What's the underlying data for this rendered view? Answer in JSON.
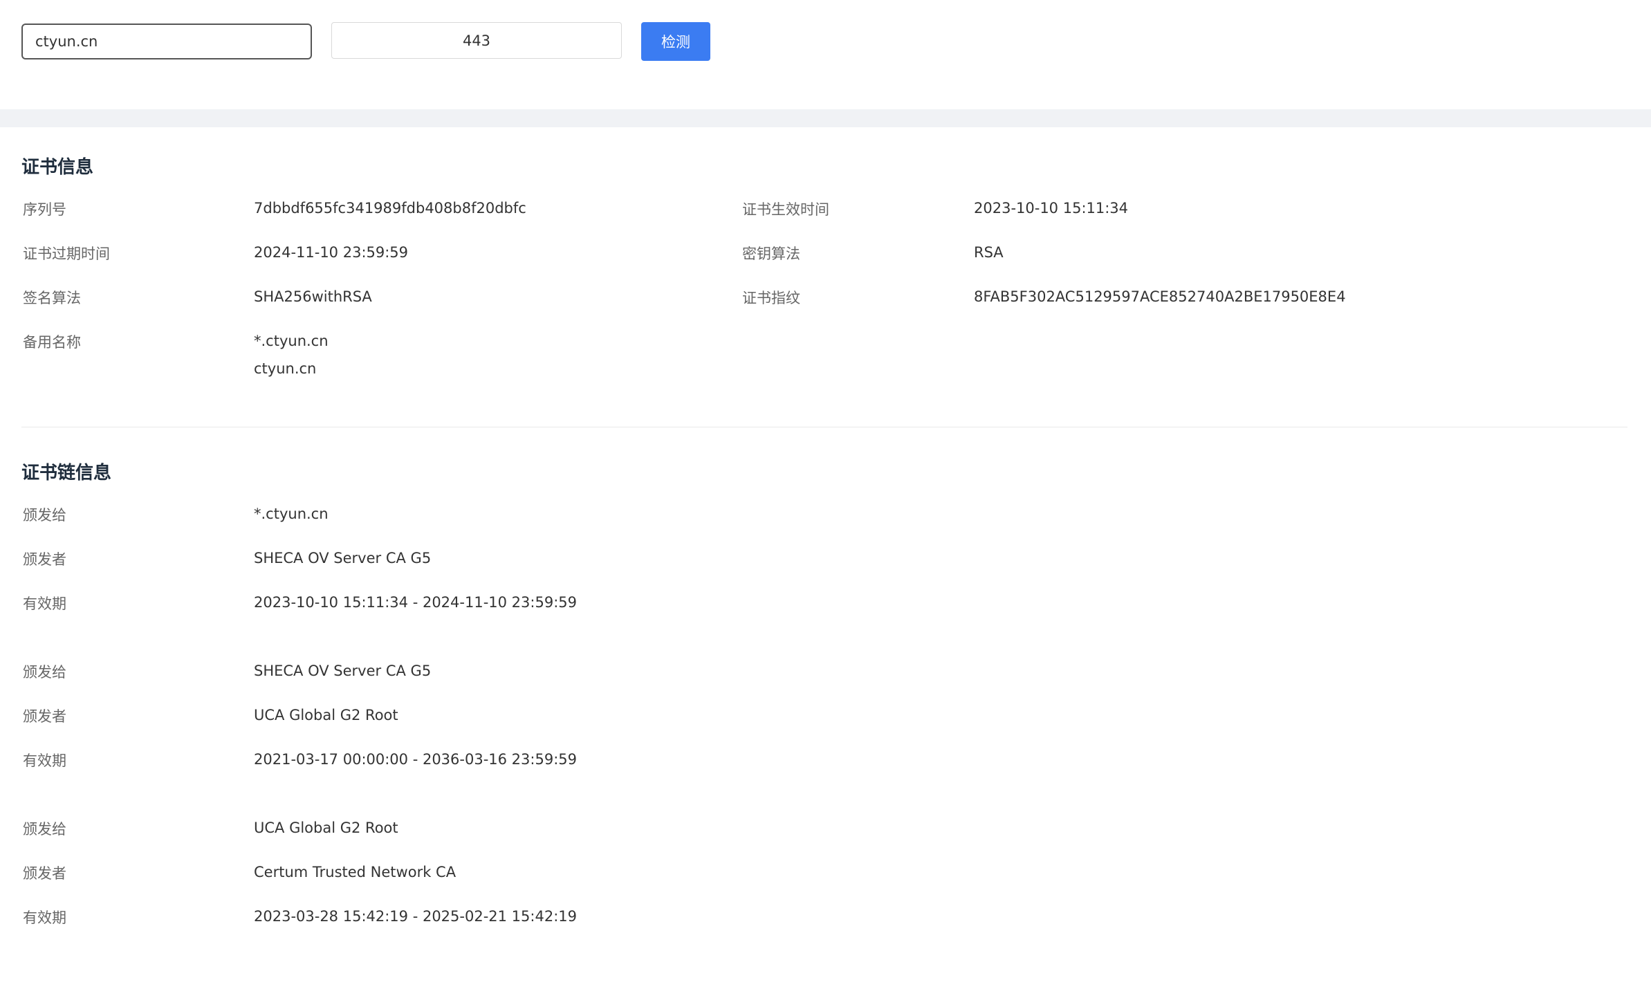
{
  "search": {
    "domain_value": "ctyun.cn",
    "port_value": "443",
    "check_label": "检测"
  },
  "cert_info": {
    "title": "证书信息",
    "serial_label": "序列号",
    "serial_value": "7dbbdf655fc341989fdb408b8f20dbfc",
    "valid_from_label": "证书生效时间",
    "valid_from_value": "2023-10-10 15:11:34",
    "expire_label": "证书过期时间",
    "expire_value": "2024-11-10 23:59:59",
    "key_algo_label": "密钥算法",
    "key_algo_value": "RSA",
    "sig_algo_label": "签名算法",
    "sig_algo_value": "SHA256withRSA",
    "fingerprint_label": "证书指纹",
    "fingerprint_value": "8FAB5F302AC5129597ACE852740A2BE17950E8E4",
    "alt_names_label": "备用名称",
    "alt_names": [
      "*.ctyun.cn",
      "ctyun.cn"
    ]
  },
  "chain_info": {
    "title": "证书链信息",
    "entries": [
      {
        "issued_to_label": "颁发给",
        "issued_to": "*.ctyun.cn",
        "issuer_label": "颁发者",
        "issuer": "SHECA OV Server CA G5",
        "validity_label": "有效期",
        "validity": "2023-10-10 15:11:34 - 2024-11-10 23:59:59"
      },
      {
        "issued_to_label": "颁发给",
        "issued_to": "SHECA OV Server CA G5",
        "issuer_label": "颁发者",
        "issuer": "UCA Global G2 Root",
        "validity_label": "有效期",
        "validity": "2021-03-17 00:00:00 - 2036-03-16 23:59:59"
      },
      {
        "issued_to_label": "颁发给",
        "issued_to": "UCA Global G2 Root",
        "issuer_label": "颁发者",
        "issuer": "Certum Trusted Network CA",
        "validity_label": "有效期",
        "validity": "2023-03-28 15:42:19 - 2025-02-21 15:42:19"
      }
    ]
  },
  "colors": {
    "primary": "#3b7cf2",
    "title": "#1f2d3d",
    "label": "#666666",
    "value": "#333333",
    "band": "#f0f2f5"
  }
}
